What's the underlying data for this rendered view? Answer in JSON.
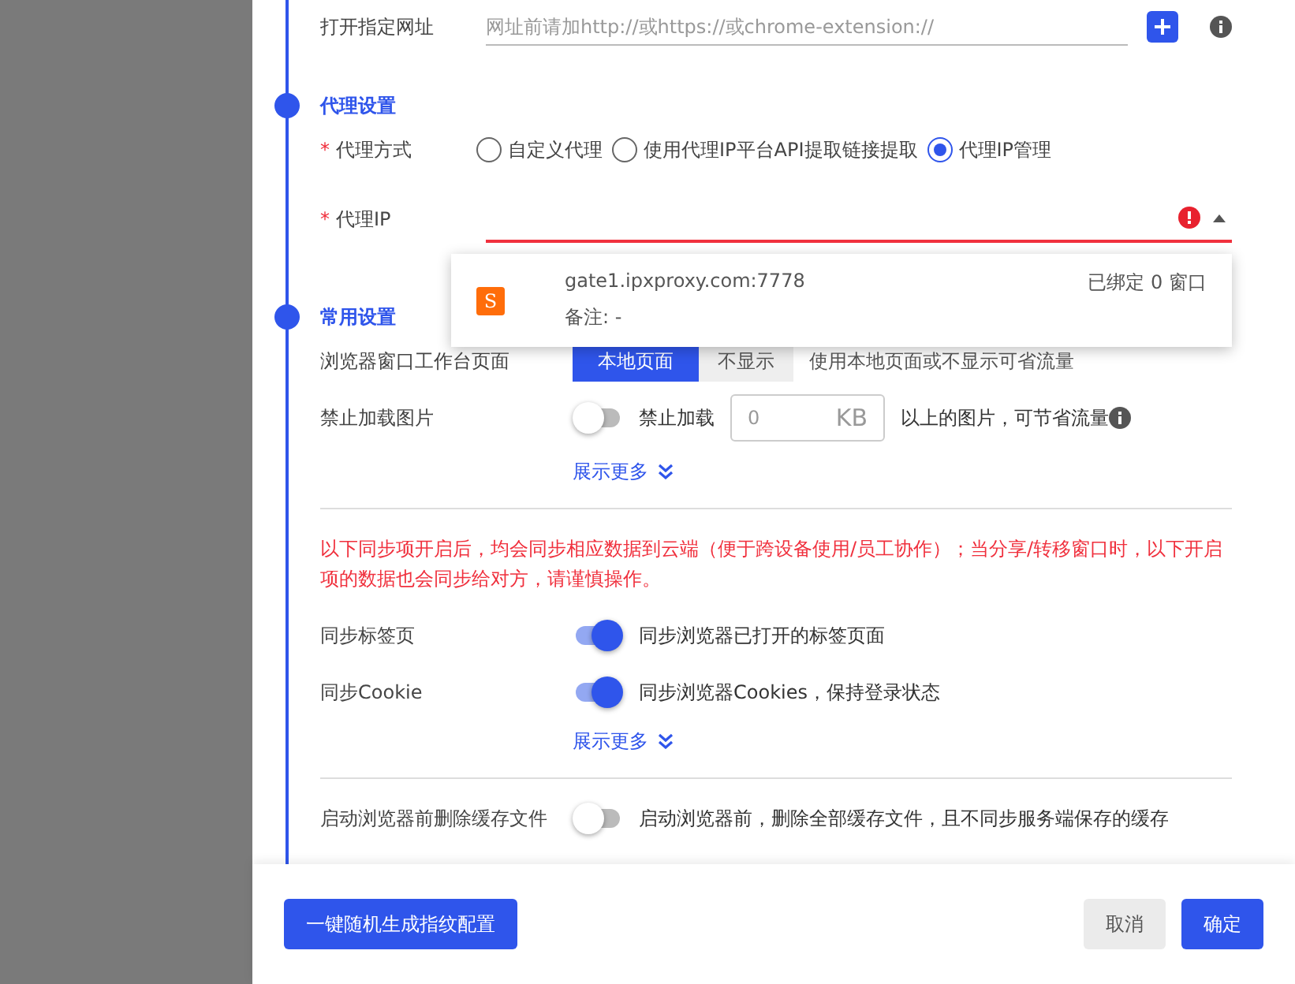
{
  "url_row": {
    "label": "打开指定网址",
    "placeholder": "网址前请加http://或https://或chrome-extension://"
  },
  "proxy": {
    "title": "代理设置",
    "mode": {
      "marker": "*",
      "label": "代理方式",
      "options": [
        {
          "label": "自定义代理",
          "selected": false
        },
        {
          "label": "使用代理IP平台API提取链接提取",
          "selected": false
        },
        {
          "label": "代理IP管理",
          "selected": true
        }
      ]
    },
    "ip": {
      "marker": "*",
      "label": "代理IP",
      "error": true,
      "expanded": true,
      "options": [
        {
          "host": "gate1.ipxproxy.com:7778",
          "note": "备注: -",
          "bound": "已绑定 0 窗口",
          "badge": "S"
        }
      ]
    }
  },
  "common": {
    "title": "常用设置",
    "workbench": {
      "label": "浏览器窗口工作台页面",
      "segments": [
        {
          "label": "本地页面",
          "selected": true
        },
        {
          "label": "不显示",
          "selected": false
        }
      ],
      "hint": "使用本地页面或不显示可省流量"
    },
    "images": {
      "label": "禁止加载图片",
      "on": false,
      "prefix": "禁止加载",
      "value": "0",
      "unit": "KB",
      "suffix": "以上的图片，可节省流量"
    },
    "more": "展示更多",
    "warning": "以下同步项开启后，均会同步相应数据到云端（便于跨设备使用/员工协作）；当分享/转移窗口时，以下开启项的数据也会同步给对方，请谨慎操作。",
    "sync": [
      {
        "label": "同步标签页",
        "on": true,
        "desc": "同步浏览器已打开的标签页面"
      },
      {
        "label": "同步Cookie",
        "on": true,
        "desc": "同步浏览器Cookies，保持登录状态"
      }
    ],
    "more2": "展示更多",
    "cache": {
      "label": "启动浏览器前删除缓存文件",
      "on": false,
      "desc": "启动浏览器前，删除全部缓存文件，且不同步服务端保存的缓存"
    }
  },
  "footer": {
    "random_button": "一键随机生成指纹配置",
    "cancel": "取消",
    "confirm": "确定"
  }
}
